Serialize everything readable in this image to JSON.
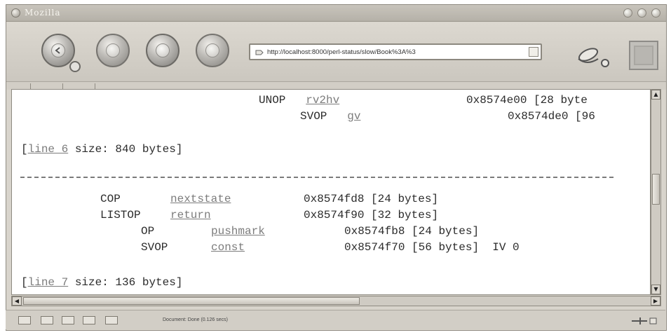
{
  "window": {
    "title": "Mozilla"
  },
  "toolbar": {
    "url": "http://localhost:8000/perl-status/slow/Book%3A%3"
  },
  "content": {
    "rows": [
      {
        "op": "UNOP",
        "link": "rv2hv",
        "addr": "0x8574e00",
        "size": "[28 byte"
      },
      {
        "op": "SVOP",
        "link": "gv",
        "addr": "0x8574de0",
        "size": "[96"
      }
    ],
    "line6": {
      "prefix": "[",
      "link": "line 6",
      "suffix": " size: 840 bytes]"
    },
    "rows2": [
      {
        "op": "COP",
        "link": "nextstate",
        "addr": "0x8574fd8",
        "size": "[24 bytes]",
        "extra": ""
      },
      {
        "op": "LISTOP",
        "link": "return",
        "addr": "0x8574f90",
        "size": "[32 bytes]",
        "extra": ""
      },
      {
        "op": "OP",
        "link": "pushmark",
        "addr": "0x8574fb8",
        "size": "[24 bytes]",
        "extra": ""
      },
      {
        "op": "SVOP",
        "link": "const",
        "addr": "0x8574f70",
        "size": "[56 bytes]",
        "extra": "IV 0"
      }
    ],
    "line7": {
      "prefix": "[",
      "link": "line 7",
      "suffix": " size: 136 bytes]"
    }
  },
  "statusbar": {
    "text": "Document: Done (0.126 secs)"
  }
}
